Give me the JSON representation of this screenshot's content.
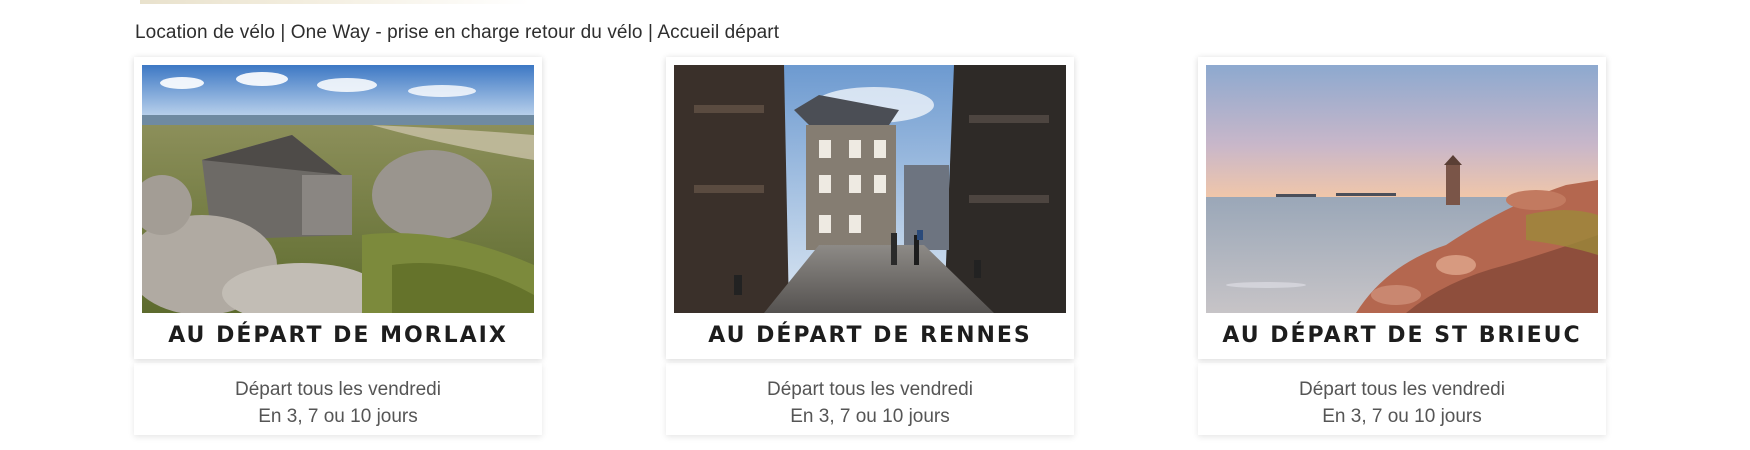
{
  "breadcrumb": {
    "text": "Location de vélo | One Way - prise en charge retour du vélo | Accueil départ"
  },
  "cards": [
    {
      "title": "AU DÉPART DE MORLAIX",
      "line1": "Départ tous les vendredi",
      "line2": "En 3, 7 ou 10 jours",
      "image": "coastal-stone-house-photo"
    },
    {
      "title": "AU DÉPART DE RENNES",
      "line1": "Départ tous les vendredi",
      "line2": "En 3, 7 ou 10 jours",
      "image": "old-town-street-photo"
    },
    {
      "title": "AU DÉPART DE ST BRIEUC",
      "line1": "Départ tous les vendredi",
      "line2": "En 3, 7 ou 10 jours",
      "image": "lighthouse-pink-granite-photo"
    }
  ]
}
